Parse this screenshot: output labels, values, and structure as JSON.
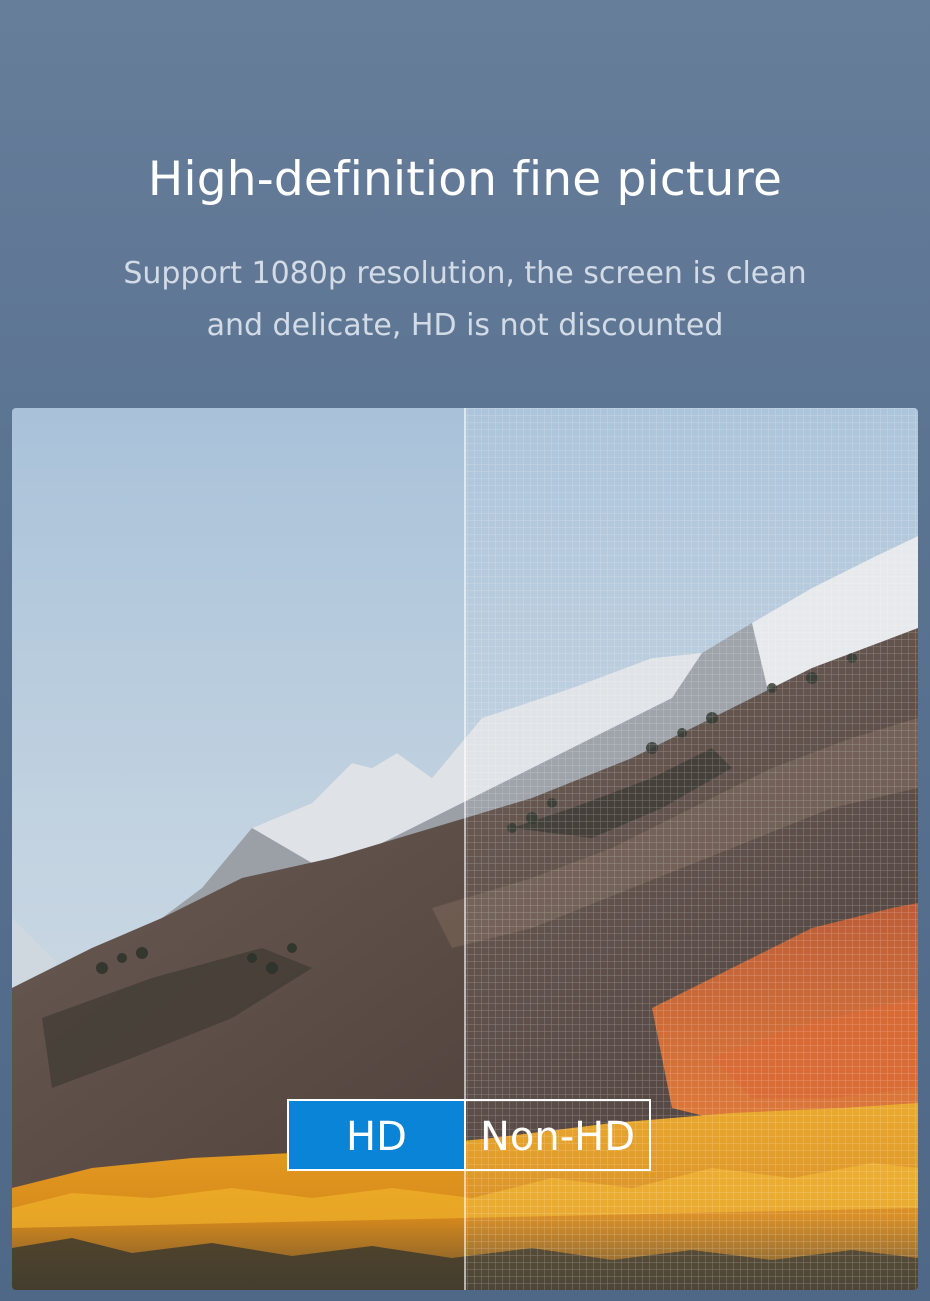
{
  "header": {
    "title": "High-definition fine picture",
    "subtitle_line1": "Support 1080p resolution, the screen is clean",
    "subtitle_line2": "and delicate, HD is not discounted"
  },
  "comparison": {
    "hd_label": "HD",
    "non_hd_label": "Non-HD",
    "hd_color": "#0a84d6"
  },
  "image": {
    "subject": "mountain-landscape-icon"
  }
}
